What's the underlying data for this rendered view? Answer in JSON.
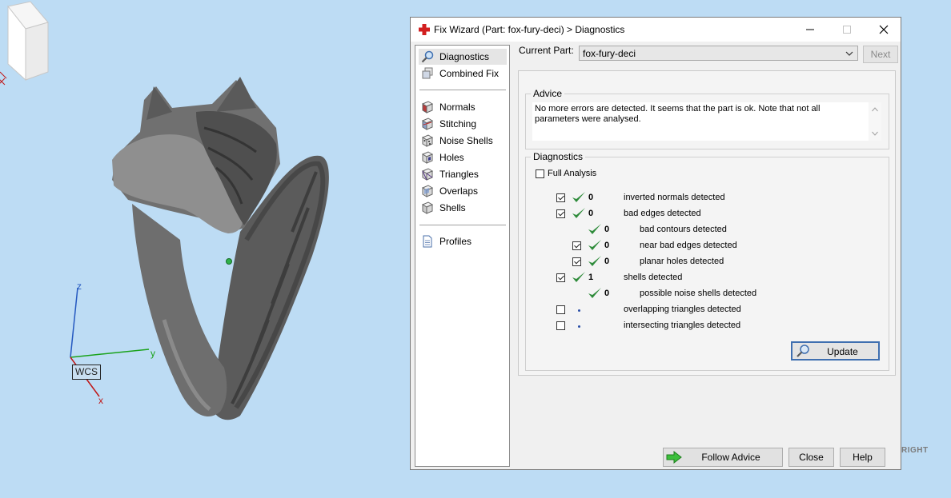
{
  "viewport": {
    "wcs_label": "WCS",
    "axis_x": "x",
    "axis_y": "y",
    "axis_z": "z",
    "view_cube_label": "RIGHT"
  },
  "dialog": {
    "title": "Fix Wizard (Part: fox-fury-deci) > Diagnostics",
    "nav": {
      "top_items": [
        {
          "label": "Diagnostics",
          "icon": "magnifier-icon",
          "selected": true
        },
        {
          "label": "Combined Fix",
          "icon": "cube-stack-icon"
        }
      ],
      "fix_items": [
        {
          "label": "Normals",
          "icon": "normals-cube-icon"
        },
        {
          "label": "Stitching",
          "icon": "stitching-cube-icon"
        },
        {
          "label": "Noise Shells",
          "icon": "noise-shells-icon"
        },
        {
          "label": "Holes",
          "icon": "holes-cube-icon"
        },
        {
          "label": "Triangles",
          "icon": "triangles-cube-icon"
        },
        {
          "label": "Overlaps",
          "icon": "overlaps-cube-icon"
        },
        {
          "label": "Shells",
          "icon": "shells-cube-icon"
        }
      ],
      "bottom_items": [
        {
          "label": "Profiles",
          "icon": "document-icon"
        }
      ]
    },
    "current_part_label": "Current Part:",
    "current_part_value": "fox-fury-deci",
    "next_label": "Next",
    "advice": {
      "title": "Advice",
      "text": "No more errors are detected. It seems that the part is ok. Note that not all parameters were analysed."
    },
    "diagnostics": {
      "title": "Diagnostics",
      "full_analysis_label": "Full Analysis",
      "rows": [
        {
          "checkbox": true,
          "checked": true,
          "status": "ok",
          "count": "0",
          "label": "inverted normals detected",
          "indent": 0
        },
        {
          "checkbox": true,
          "checked": true,
          "status": "ok",
          "count": "0",
          "label": "bad edges detected",
          "indent": 0
        },
        {
          "checkbox": false,
          "checked": false,
          "status": "ok",
          "count": "0",
          "label": "bad contours detected",
          "indent": 1
        },
        {
          "checkbox": true,
          "checked": true,
          "status": "ok",
          "count": "0",
          "label": "near bad edges detected",
          "indent": 1
        },
        {
          "checkbox": true,
          "checked": true,
          "status": "ok",
          "count": "0",
          "label": "planar holes detected",
          "indent": 1
        },
        {
          "checkbox": true,
          "checked": true,
          "status": "ok",
          "count": "1",
          "label": "shells detected",
          "indent": 0
        },
        {
          "checkbox": false,
          "checked": false,
          "status": "ok",
          "count": "0",
          "label": "possible noise shells detected",
          "indent": 1
        },
        {
          "checkbox": true,
          "checked": false,
          "status": "pending",
          "count": "",
          "label": "overlapping triangles detected",
          "indent": 0
        },
        {
          "checkbox": true,
          "checked": false,
          "status": "pending",
          "count": "",
          "label": "intersecting triangles detected",
          "indent": 0
        }
      ],
      "update_label": "Update"
    },
    "footer": {
      "follow_advice_label": "Follow Advice",
      "close_label": "Close",
      "help_label": "Help"
    },
    "colors": {
      "accent": "#3f6fb0",
      "ok_check": "#2e8b3a",
      "title_icon": "#d21f1f"
    }
  }
}
